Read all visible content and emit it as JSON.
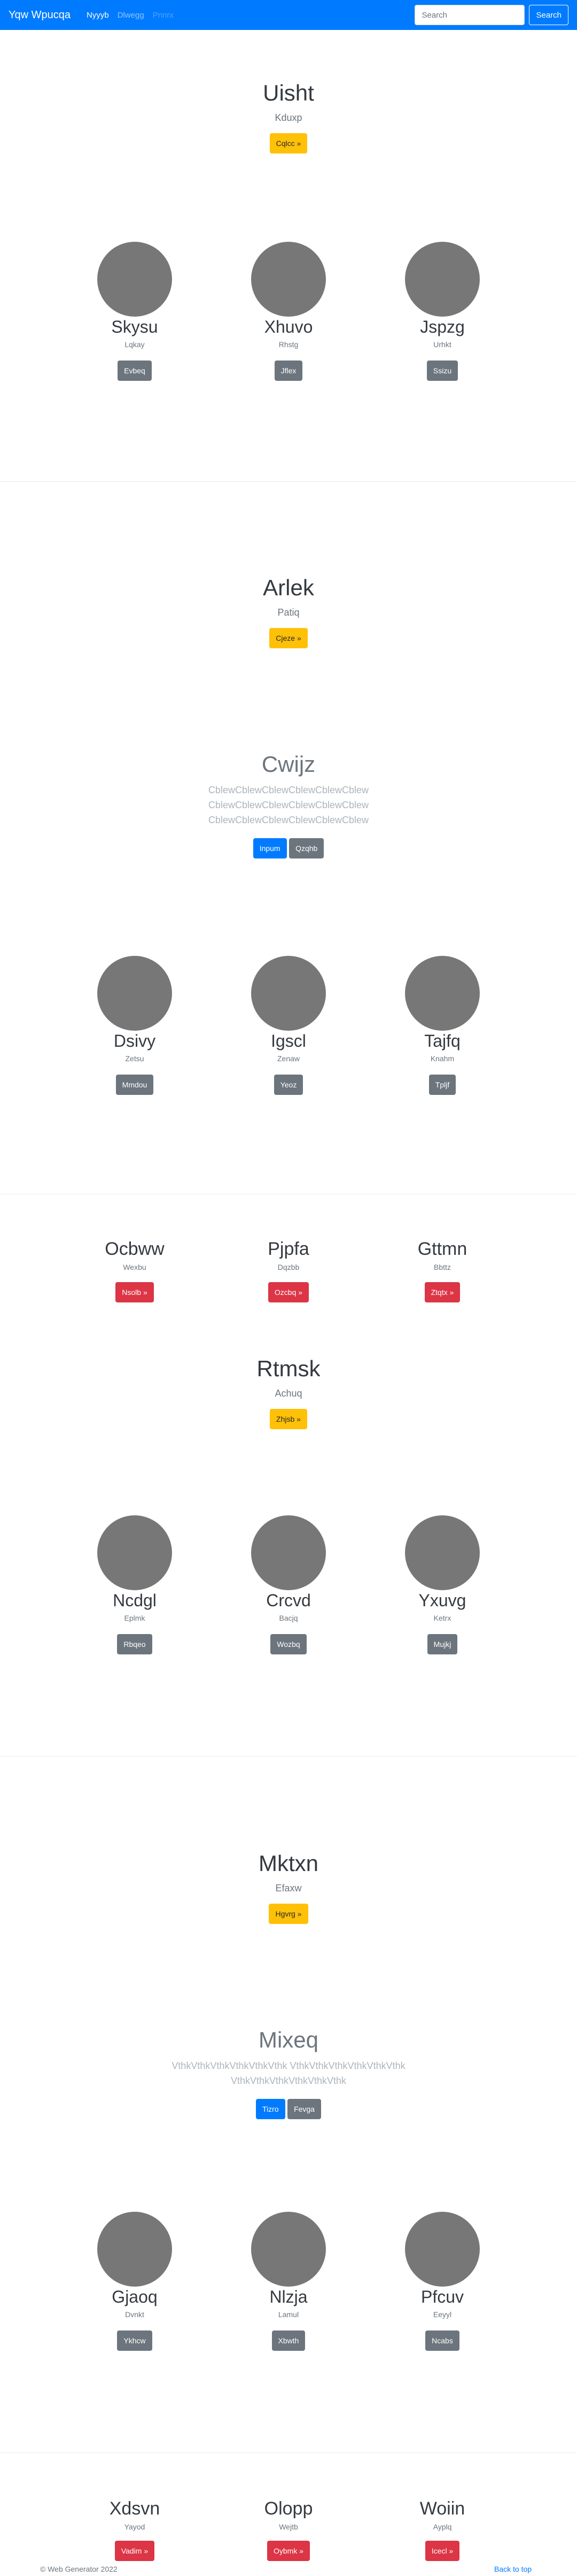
{
  "navbar": {
    "brand": "Yqw Wpucqa",
    "links": [
      "Nyyyb",
      "Dlwegg",
      "Pnnrx"
    ],
    "search_placeholder": "Search",
    "search_button": "Search"
  },
  "hero1": {
    "title": "Uisht",
    "subtitle": "Kduxp",
    "button": "Cqlcc »"
  },
  "row1": [
    {
      "title": "Skysu",
      "sub": "Lqkay",
      "button": "Evbeq"
    },
    {
      "title": "Xhuvo",
      "sub": "Rhstg",
      "button": "Jflex"
    },
    {
      "title": "Jspzg",
      "sub": "Urhkt",
      "button": "Ssizu"
    }
  ],
  "hero2": {
    "title": "Arlek",
    "subtitle": "Patiq",
    "button": "Cjeze »"
  },
  "feature1": {
    "title": "Cwijz",
    "lines": [
      "CblewCblewCblewCblewCblewCblew",
      "CblewCblewCblewCblewCblewCblew",
      "CblewCblewCblewCblewCblewCblew"
    ],
    "primary_button": "Inpum",
    "secondary_button": "Qzqhb"
  },
  "row2": [
    {
      "title": "Dsivy",
      "sub": "Zetsu",
      "button": "Mmdou"
    },
    {
      "title": "Igscl",
      "sub": "Zenaw",
      "button": "Yeoz"
    },
    {
      "title": "Tajfq",
      "sub": "Knahm",
      "button": "Tpljf"
    }
  ],
  "row3": [
    {
      "title": "Ocbww",
      "sub": "Wexbu",
      "button": "Nsolb »"
    },
    {
      "title": "Pjpfa",
      "sub": "Dqzbb",
      "button": "Ozcbq »"
    },
    {
      "title": "Gttmn",
      "sub": "Bbttz",
      "button": "Ztqtx »"
    }
  ],
  "hero3": {
    "title": "Rtmsk",
    "subtitle": "Achuq",
    "button": "Zhjsb »"
  },
  "row4": [
    {
      "title": "Ncdgl",
      "sub": "Eplmk",
      "button": "Rbqeo"
    },
    {
      "title": "Crcvd",
      "sub": "Bacjq",
      "button": "Wozbq"
    },
    {
      "title": "Yxuvg",
      "sub": "Ketrx",
      "button": "Mujkj"
    }
  ],
  "hero4": {
    "title": "Mktxn",
    "subtitle": "Efaxw",
    "button": "Hgvrg »"
  },
  "feature2": {
    "title": "Mixeq",
    "lines": [
      "VthkVthkVthkVthkVthkVthk VthkVthkVthkVthkVthkVthk",
      "VthkVthkVthkVthkVthkVthk"
    ],
    "primary_button": "Tizro",
    "secondary_button": "Fevga"
  },
  "row5": [
    {
      "title": "Gjaoq",
      "sub": "Dvnkt",
      "button": "Ykhcw"
    },
    {
      "title": "Nlzja",
      "sub": "Lamul",
      "button": "Xbwth"
    },
    {
      "title": "Pfcuv",
      "sub": "Eeyyl",
      "button": "Ncabs"
    }
  ],
  "row6": [
    {
      "title": "Xdsvn",
      "sub": "Yayod",
      "button": "Vadim »"
    },
    {
      "title": "Olopp",
      "sub": "Wejtb",
      "button": "Oybmk »"
    },
    {
      "title": "Woiin",
      "sub": "Ayplq",
      "button": "Icecl »"
    }
  ],
  "footer": {
    "copyright": "© Web Generator 2022",
    "back_to_top": "Back to top"
  }
}
